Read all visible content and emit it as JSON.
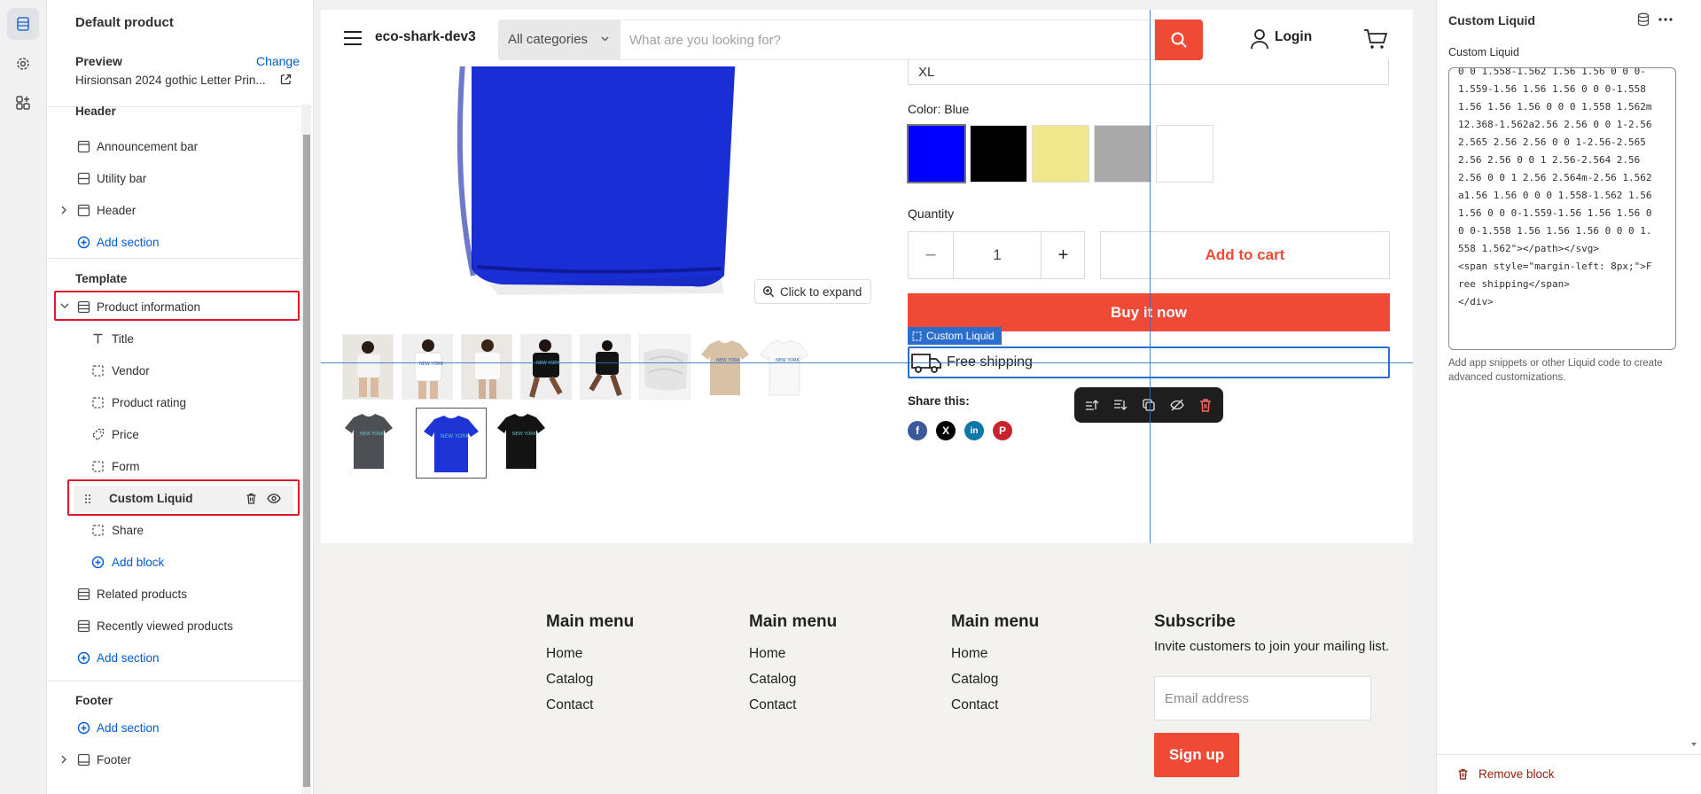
{
  "sidebar": {
    "title": "Default product",
    "preview_label": "Preview",
    "change_label": "Change",
    "preview_value": "Hirsionsan 2024 gothic Letter Prin...",
    "groups": {
      "header": "Header",
      "template": "Template",
      "footer": "Footer"
    },
    "header_items": [
      "Announcement bar",
      "Utility bar",
      "Header"
    ],
    "add_section": "Add section",
    "template_section": "Product information",
    "blocks": [
      "Title",
      "Vendor",
      "Product rating",
      "Price",
      "Form",
      "Custom Liquid",
      "Share"
    ],
    "add_block": "Add block",
    "template_items": [
      "Related products",
      "Recently viewed products"
    ],
    "footer_item": "Footer"
  },
  "store": {
    "brand": "eco-shark-dev3",
    "category_select": "All categories",
    "search_placeholder": "What are you looking for?",
    "login": "Login",
    "click_to_expand": "Click to expand",
    "size_value": "XL",
    "color_label": "Color: Blue",
    "swatches": [
      "#0000ff",
      "#000000",
      "#f0e68c",
      "#a9a9a9",
      "#ffffff"
    ],
    "quantity_label": "Quantity",
    "quantity_minus": "−",
    "quantity_value": "1",
    "quantity_plus": "+",
    "add_to_cart": "Add to cart",
    "buy_now": "Buy it now",
    "custom_liquid_tag": "Custom Liquid",
    "free_shipping": "Free shipping",
    "share_label": "Share this:",
    "footer": {
      "columns": [
        {
          "title": "Main menu",
          "links": [
            "Home",
            "Catalog",
            "Contact"
          ]
        },
        {
          "title": "Main menu",
          "links": [
            "Home",
            "Catalog",
            "Contact"
          ]
        },
        {
          "title": "Main menu",
          "links": [
            "Home",
            "Catalog",
            "Contact"
          ]
        }
      ],
      "subscribe_title": "Subscribe",
      "subscribe_text": "Invite customers to join your mailing list.",
      "email_placeholder": "Email address",
      "signup": "Sign up"
    }
  },
  "settings": {
    "title": "Custom Liquid",
    "field_label": "Custom Liquid",
    "code": "0 0 1.558-1.562 1.56 1.56 0 0 0-1.559-1.56 1.56 1.56 0 0 0-1.558 1.56 1.56 1.56 0 0 0 1.558 1.562m12.368-1.562a2.56 2.56 0 0 1-2.56 2.565 2.56 2.56 0 0 1-2.56-2.565 2.56 2.56 0 0 1 2.56-2.564 2.56 2.56 0 0 1 2.56 2.564m-2.56 1.562a1.56 1.56 0 0 0 1.558-1.562 1.56 1.56 0 0 0-1.559-1.56 1.56 1.56 0 0 0-1.558 1.56 1.56 1.56 0 0 0 1.558 1.562\"></path></svg>\n<span style=\"margin-left: 8px;\">Free shipping</span>\n</div>",
    "help": "Add app snippets or other Liquid code to create advanced customizations.",
    "remove_block": "Remove block"
  }
}
